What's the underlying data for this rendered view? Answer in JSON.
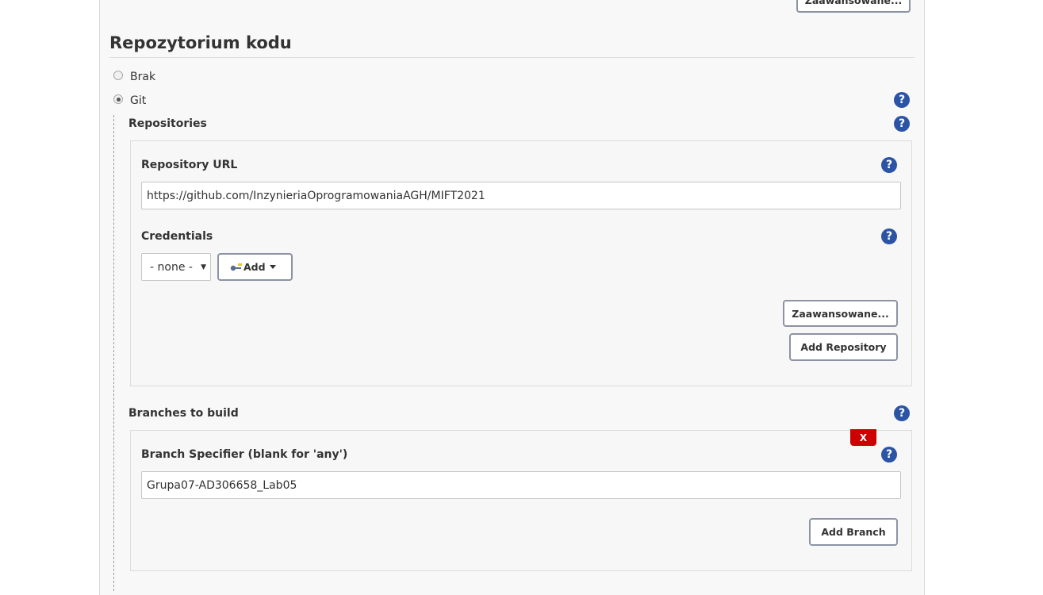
{
  "top_advanced_button": "Zaawansowane...",
  "section_title": "Repozytorium kodu",
  "scm_options": [
    {
      "label": "Brak",
      "checked": false
    },
    {
      "label": "Git",
      "checked": true
    }
  ],
  "help_symbol": "?",
  "git": {
    "repositories_label": "Repositories",
    "repository": {
      "url_label": "Repository URL",
      "url_value": "https://github.com/InzynieriaOprogramowaniaAGH/MIFT2021",
      "credentials_label": "Credentials",
      "credentials_selected": "- none -",
      "add_button": "Add",
      "advanced_button": "Zaawansowane...",
      "add_repository_button": "Add Repository"
    },
    "branches_label": "Branches to build",
    "branch": {
      "delete_button": "X",
      "specifier_label": "Branch Specifier (blank for 'any')",
      "specifier_value": "Grupa07-AD306658_Lab05",
      "add_branch_button": "Add Branch"
    }
  },
  "colors": {
    "help_icon": "#2c54a5",
    "delete_button": "#cc0000",
    "button_border": "#8c93a4"
  }
}
